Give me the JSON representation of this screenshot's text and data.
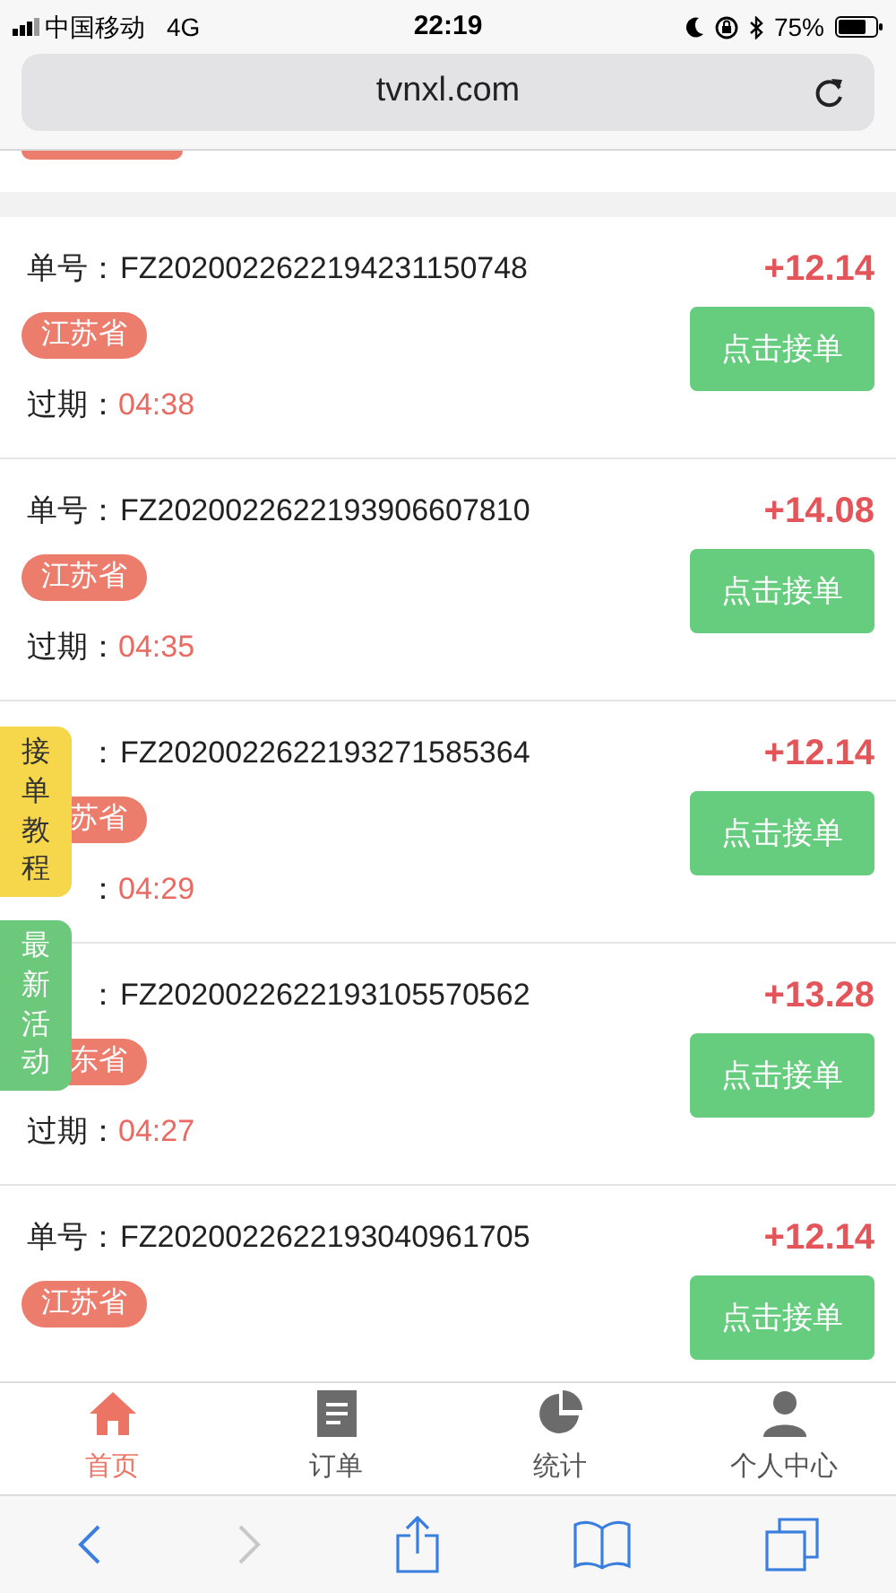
{
  "status_bar": {
    "carrier": "中国移动",
    "network": "4G",
    "time": "22:19",
    "battery": "75%"
  },
  "address_bar": {
    "url": "tvnxl.com"
  },
  "orders": [
    {
      "label": "单号：",
      "number": "FZ2020022622194231150748",
      "amount": "+12.14",
      "province": "江苏省",
      "expiry_label": "过期：",
      "expiry": "04:38",
      "button": "点击接单"
    },
    {
      "label": "单号：",
      "number": "FZ2020022622193906607810",
      "amount": "+14.08",
      "province": "江苏省",
      "expiry_label": "过期：",
      "expiry": "04:35",
      "button": "点击接单"
    },
    {
      "label": "：",
      "number": "FZ2020022622193271585364",
      "amount": "+12.14",
      "province": "苏省",
      "expiry_label": "：",
      "expiry": "04:29",
      "button": "点击接单"
    },
    {
      "label": "：",
      "number": "FZ2020022622193105570562",
      "amount": "+13.28",
      "province": "东省",
      "expiry_label": "过期：",
      "expiry": "04:27",
      "button": "点击接单"
    },
    {
      "label": "单号：",
      "number": "FZ2020022622193040961705",
      "amount": "+12.14",
      "province": "江苏省",
      "button": "点击接单"
    }
  ],
  "floating_tabs": [
    {
      "kind": "tutorial",
      "label": "接单教程"
    },
    {
      "kind": "events",
      "label": "最新活动"
    }
  ],
  "tab_bar": [
    {
      "kind": "home",
      "label": "首页",
      "selected": true
    },
    {
      "kind": "orders",
      "label": "订单",
      "selected": false
    },
    {
      "kind": "stats",
      "label": "统计",
      "selected": false
    },
    {
      "kind": "profile",
      "label": "个人中心",
      "selected": false
    }
  ]
}
